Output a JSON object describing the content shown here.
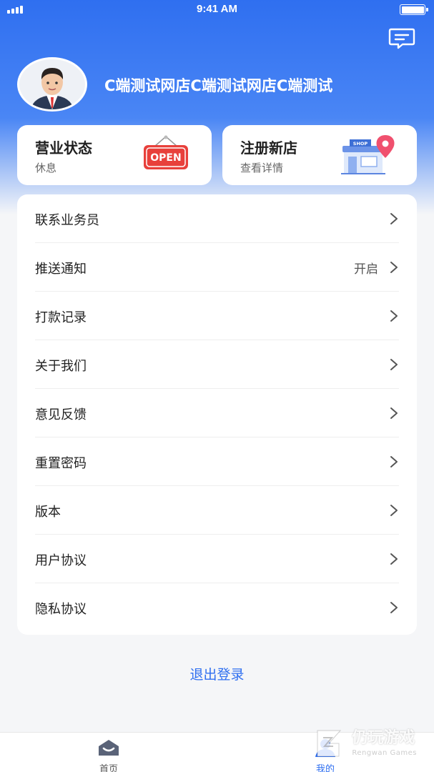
{
  "status_bar": {
    "time": "9:41 AM"
  },
  "header": {
    "shop_name": "C端测试网店C端测试网店C端测试"
  },
  "cards": [
    {
      "title": "营业状态",
      "subtitle": "休息",
      "illustration": "open-sign"
    },
    {
      "title": "注册新店",
      "subtitle": "查看详情",
      "illustration": "shop-pin"
    }
  ],
  "menu": [
    {
      "label": "联系业务员",
      "value": ""
    },
    {
      "label": "推送通知",
      "value": "开启"
    },
    {
      "label": "打款记录",
      "value": ""
    },
    {
      "label": "关于我们",
      "value": ""
    },
    {
      "label": "意见反馈",
      "value": ""
    },
    {
      "label": "重置密码",
      "value": ""
    },
    {
      "label": "版本",
      "value": ""
    },
    {
      "label": "用户协议",
      "value": ""
    },
    {
      "label": "隐私协议",
      "value": ""
    }
  ],
  "logout_label": "退出登录",
  "tabbar": {
    "home_label": "首页",
    "mine_label": "我的"
  },
  "illustrations": {
    "open_sign_text": "OPEN",
    "shop_sign_text": "SHOP"
  },
  "watermark": {
    "title": "仍玩游戏",
    "subtitle": "Rengwan Games"
  },
  "colors": {
    "primary": "#2f6ff0",
    "open_red": "#e8403b",
    "pin_pink": "#f0506e"
  }
}
